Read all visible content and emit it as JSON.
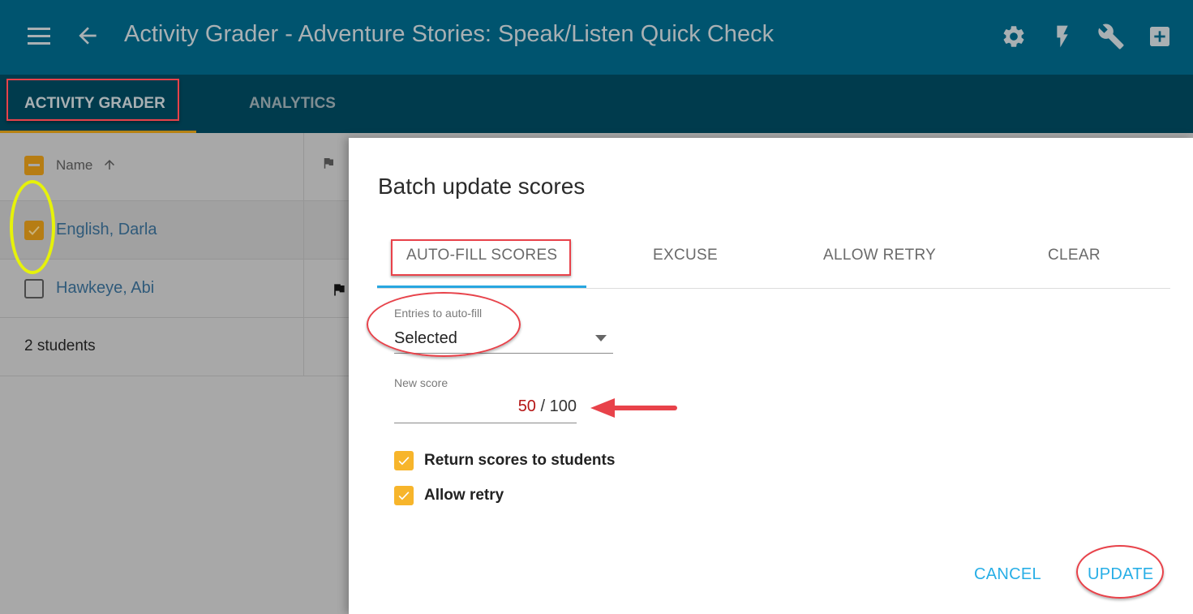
{
  "app_bar": {
    "title": "Activity Grader - Adventure Stories: Speak/Listen Quick Check",
    "icons": [
      "menu-icon",
      "back-arrow-icon",
      "gear-icon",
      "lightning-icon",
      "wrench-icon",
      "add-box-icon"
    ]
  },
  "tabs": [
    {
      "label": "ACTIVITY GRADER",
      "active": true
    },
    {
      "label": "ANALYTICS",
      "active": false
    }
  ],
  "grid": {
    "header": {
      "name_label": "Name",
      "sort": "ascending",
      "select_all_state": "indeterminate"
    },
    "rows": [
      {
        "name": "English, Darla",
        "selected": true,
        "flagged": false
      },
      {
        "name": "Hawkeye, Abi",
        "selected": false,
        "flagged": true
      }
    ],
    "footer": "2 students"
  },
  "dialog": {
    "title": "Batch update scores",
    "tabs": [
      {
        "label": "AUTO-FILL SCORES",
        "active": true
      },
      {
        "label": "EXCUSE",
        "active": false
      },
      {
        "label": "ALLOW RETRY",
        "active": false
      },
      {
        "label": "CLEAR",
        "active": false
      }
    ],
    "entries_field": {
      "label": "Entries to auto-fill",
      "value": "Selected"
    },
    "score_field": {
      "label": "New score",
      "value": "50",
      "separator": "/",
      "max": "100"
    },
    "checkboxes": [
      {
        "label": "Return scores to students",
        "checked": true
      },
      {
        "label": "Allow retry",
        "checked": true
      }
    ],
    "buttons": {
      "cancel": "CANCEL",
      "update": "UPDATE"
    }
  },
  "colors": {
    "app_bar": "#00546f",
    "tab_bar": "#003b4d",
    "accent_gold": "#b68214",
    "dialog_accent": "#28a7e0",
    "checkbox": "#f7b52b",
    "score_value": "#b51616",
    "annotation_red": "#e8424a",
    "annotation_yellow": "#e6f20a"
  }
}
